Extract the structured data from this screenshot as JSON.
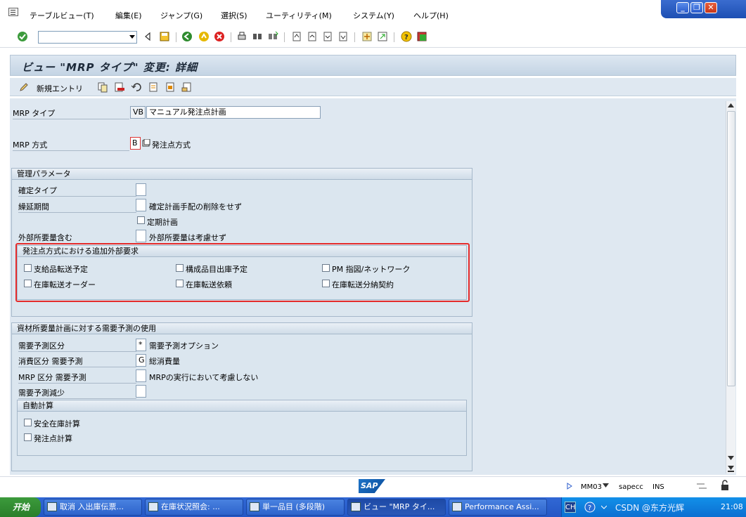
{
  "menu": {
    "items": [
      "テーブルビュー(T)",
      "編集(E)",
      "ジャンプ(G)",
      "選択(S)",
      "ユーティリティ(M)",
      "システム(Y)",
      "ヘルプ(H)"
    ]
  },
  "window_controls": [
    "_",
    "❐",
    "✕"
  ],
  "title": "ビュー \"MRP タイプ\" 変更: 詳細",
  "app_toolbar": {
    "new_entries": "新規エントリ"
  },
  "fields": {
    "mrp_type_label": "MRP タイプ",
    "mrp_type_code": "VB",
    "mrp_type_desc": "マニュアル発注点計画",
    "mrp_method_label": "MRP 方式",
    "mrp_method_code": "B",
    "mrp_method_desc": "発注点方式"
  },
  "control_params": {
    "title": "管理パラメータ",
    "firm_type_label": "確定タイプ",
    "rollforward_label": "繰延期間",
    "rollforward_desc": "確定計画手配の削除をせず",
    "periodic_planning": "定期計画",
    "ext_req_label": "外部所要量含む",
    "ext_req_desc": "外部所要量は考慮せず"
  },
  "reorder_group": {
    "title": "発注点方式における追加外部要求",
    "items": [
      "支給品転送予定",
      "構成品目出庫予定",
      "PM 指図/ネットワーク",
      "在庫転送オーダー",
      "在庫転送依頼",
      "在庫転送分納契約"
    ]
  },
  "forecast_group": {
    "title": "資材所要量計画に対する需要予測の使用",
    "forecast_ind_label": "需要予測区分",
    "forecast_ind_value": "*",
    "forecast_ind_desc": "需要予測オプション",
    "consumption_label": "消費区分 需要予測",
    "consumption_value": "G",
    "consumption_desc": "総消費量",
    "mrp_forecast_label": "MRP 区分 需要予測",
    "mrp_forecast_desc": "MRPの実行において考慮しない",
    "reduce_label": "需要予測減少"
  },
  "auto_calc": {
    "title": "自動計算",
    "safety_stock": "安全在庫計算",
    "reorder_point": "発注点計算"
  },
  "status": {
    "transaction": "MM03",
    "server": "sapecc",
    "mode": "INS",
    "logo": "SAP"
  },
  "taskbar": {
    "start": "开始",
    "tasks": [
      "取消 入出庫伝票...",
      "在庫状況照会: ...",
      "単一品目 (多段階)",
      "ビュー \"MRP タイ...",
      "Performance Assi..."
    ],
    "lang": "CH",
    "watermark": "CSDN @东方光辉",
    "time": "21:08"
  },
  "colors": {
    "content_bg": "#dfe8f1",
    "highlight_border": "#e52b2b",
    "taskbar": "#2457c5"
  }
}
